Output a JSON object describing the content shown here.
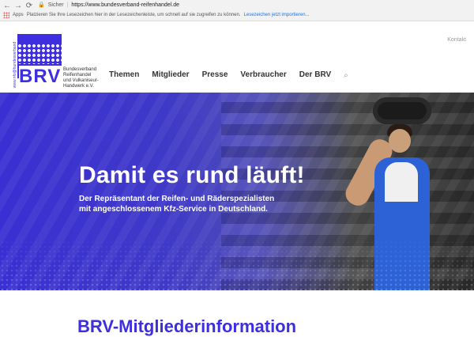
{
  "browser": {
    "back_icon": "arrow-left-icon",
    "forward_icon": "arrow-right-icon",
    "reload_icon": "reload-icon",
    "security_label": "Sicher",
    "url": "https://www.bundesverband-reifenhandel.de"
  },
  "bookmarks_bar": {
    "apps_label": "Apps",
    "message": "Platzieren Sie Ihre Lesezeichen hier in der Lesezeichenleiste, um schnell auf sie zugreifen zu können.",
    "import_link": "Lesezeichen jetzt importieren..."
  },
  "header": {
    "kontakt": "Kontakt",
    "logo_vertical_text": "www.nfo@bundesverband",
    "logo_abbr": "BRV",
    "logo_org_lines": [
      "Bundesverband",
      "Reifenhandel",
      "und Vulkaniseur-",
      "Handwerk e.V."
    ],
    "nav": [
      "Themen",
      "Mitglieder",
      "Presse",
      "Verbraucher",
      "Der BRV"
    ],
    "search_icon": "search-icon"
  },
  "hero": {
    "headline": "Damit es rund läuft!",
    "subheadline_lines": [
      "Der Repräsentant der Reifen- und Räderspezialisten",
      "mit angeschlossenem Kfz-Service in Deutschland."
    ]
  },
  "section": {
    "title": "BRV-Mitgliederinformation"
  },
  "colors": {
    "brand": "#3d2fe0"
  }
}
